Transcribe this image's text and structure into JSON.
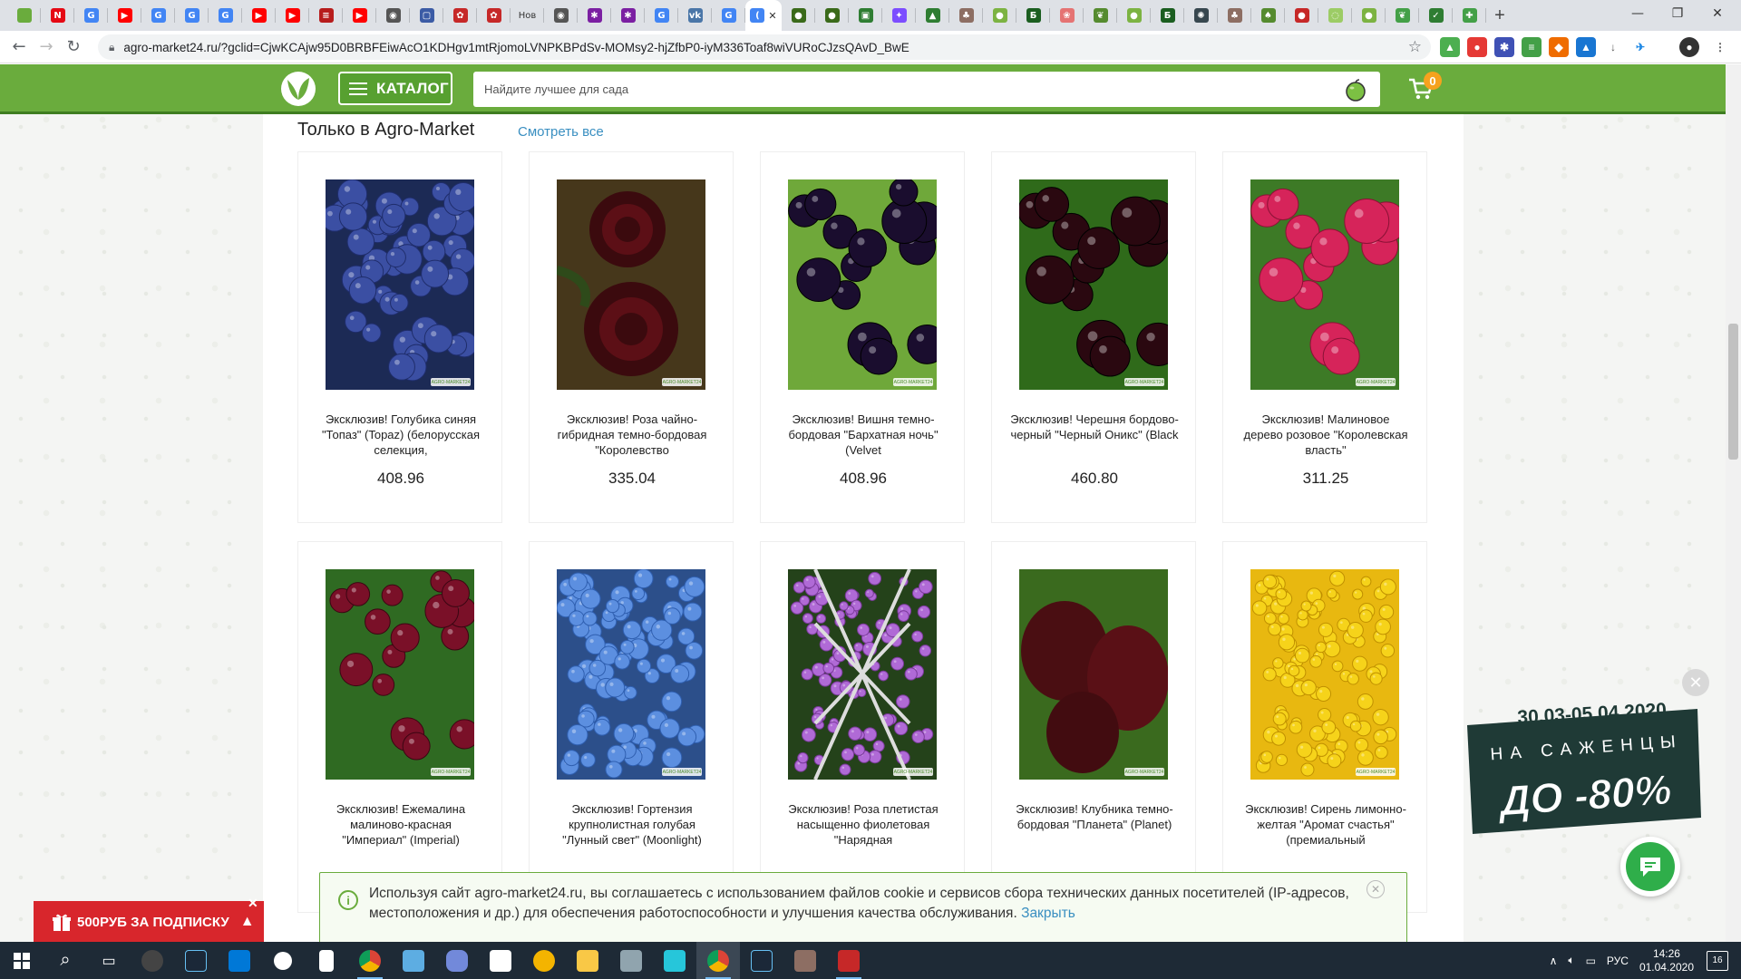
{
  "browser": {
    "url": "agro-market24.ru/?gclid=CjwKCAjw95D0BRBFEiwAcO1KDHgv1mtRjomoLVNPKBPdSv-MOMsy2-hjZfbP0-iyM336Toaf8wiVURoCJzsQAvD_BwE",
    "tabs": [
      {
        "icon": "leaf-icon",
        "color": "#6aac3d",
        "glyph": ""
      },
      {
        "icon": "netflix-icon",
        "color": "#e50914",
        "glyph": "N"
      },
      {
        "icon": "google-icon",
        "color": "#4285f4",
        "glyph": "G"
      },
      {
        "icon": "youtube-icon",
        "color": "#ff0000",
        "glyph": "▶"
      },
      {
        "icon": "google-icon",
        "color": "#4285f4",
        "glyph": "G"
      },
      {
        "icon": "google-icon",
        "color": "#4285f4",
        "glyph": "G"
      },
      {
        "icon": "google-icon",
        "color": "#4285f4",
        "glyph": "G"
      },
      {
        "icon": "youtube-icon",
        "color": "#ff0000",
        "glyph": "▶"
      },
      {
        "icon": "youtube-icon",
        "color": "#ff0000",
        "glyph": "▶"
      },
      {
        "icon": "calendar-icon",
        "color": "#b71c1c",
        "glyph": "≡"
      },
      {
        "icon": "youtube-icon",
        "color": "#ff0000",
        "glyph": "▶"
      },
      {
        "icon": "globe-icon",
        "color": "#555555",
        "glyph": "◉"
      },
      {
        "icon": "chat-icon",
        "color": "#3b5ba5",
        "glyph": "▢"
      },
      {
        "icon": "flower-icon",
        "color": "#c62828",
        "glyph": "✿"
      },
      {
        "icon": "flower-icon",
        "color": "#c62828",
        "glyph": "✿"
      },
      {
        "icon": "text-icon",
        "color": "#dee1e6",
        "glyph": "Нов"
      },
      {
        "icon": "globe-icon",
        "color": "#555555",
        "glyph": "◉"
      },
      {
        "icon": "star-icon",
        "color": "#7b1fa2",
        "glyph": "✱"
      },
      {
        "icon": "star-icon",
        "color": "#7b1fa2",
        "glyph": "✱"
      },
      {
        "icon": "google-icon",
        "color": "#4285f4",
        "glyph": "G"
      },
      {
        "icon": "vk-icon",
        "color": "#4a76a8",
        "glyph": "vk"
      },
      {
        "icon": "google-icon",
        "color": "#4285f4",
        "glyph": "G"
      },
      {
        "icon": "google-icon",
        "color": "#4285f4",
        "glyph": "("
      },
      {
        "icon": "fruit-icon",
        "color": "#3a6a1a",
        "glyph": "●"
      },
      {
        "icon": "fruit-icon",
        "color": "#3a6a1a",
        "glyph": "●"
      },
      {
        "icon": "box-icon",
        "color": "#2e7d32",
        "glyph": "▣"
      },
      {
        "icon": "sparkle-icon",
        "color": "#7c4dff",
        "glyph": "✦"
      },
      {
        "icon": "mountain-icon",
        "color": "#2e7d32",
        "glyph": "▲"
      },
      {
        "icon": "plant-icon",
        "color": "#8d6e63",
        "glyph": "♣"
      },
      {
        "icon": "apple-icon",
        "color": "#7cb342",
        "glyph": "●"
      },
      {
        "icon": "b-icon",
        "color": "#1b5e20",
        "glyph": "Б"
      },
      {
        "icon": "flower-icon",
        "color": "#e57373",
        "glyph": "❀"
      },
      {
        "icon": "leaf-icon",
        "color": "#558b2f",
        "glyph": "❦"
      },
      {
        "icon": "apple-icon",
        "color": "#7cb342",
        "glyph": "●"
      },
      {
        "icon": "b-icon",
        "color": "#1b5e20",
        "glyph": "Б"
      },
      {
        "icon": "plant-icon",
        "color": "#37474f",
        "glyph": "✺"
      },
      {
        "icon": "plant-icon",
        "color": "#8d6e63",
        "glyph": "♣"
      },
      {
        "icon": "plant-icon",
        "color": "#558b2f",
        "glyph": "♠"
      },
      {
        "icon": "berry-icon",
        "color": "#c62828",
        "glyph": "●"
      },
      {
        "icon": "leaf-icon",
        "color": "#9ccc65",
        "glyph": "◌"
      },
      {
        "icon": "leaf-icon",
        "color": "#7cb342",
        "glyph": "●"
      },
      {
        "icon": "leaf-icon",
        "color": "#43a047",
        "glyph": "❦"
      },
      {
        "icon": "leaf-icon",
        "color": "#2e7d32",
        "glyph": "✓"
      },
      {
        "icon": "leaf-icon",
        "color": "#43a047",
        "glyph": "✚"
      }
    ]
  },
  "site": {
    "catalog_label": "КАТАЛОГ",
    "search_placeholder": "Найдите лучшее для сада",
    "cart_count": "0",
    "section_title": "Только в Agro-Market",
    "see_all": "Смотреть все",
    "watermark": "AGRO-MARKET24",
    "products": [
      {
        "name": "Эксклюзив! Голубика синяя \"Топаз\" (Topaz) (белорусская селекция,",
        "price": "408.96",
        "image": "blueberry"
      },
      {
        "name": "Эксклюзив! Роза чайно-гибридная темно-бордовая \"Королевство",
        "price": "335.04",
        "image": "rose"
      },
      {
        "name": "Эксклюзив! Вишня темно-бордовая \"Бархатная ночь\" (Velvet",
        "price": "408.96",
        "image": "cherry"
      },
      {
        "name": "Эксклюзив! Черешня бордово-черный \"Черный Оникс\" (Black",
        "price": "460.80",
        "image": "sweetcherry"
      },
      {
        "name": "Эксклюзив! Малиновое дерево розовое \"Королевская власть\"",
        "price": "311.25",
        "image": "raspberry"
      },
      {
        "name": "Эксклюзив! Ежемалина малиново-красная \"Империал\" (Imperial)",
        "price": "",
        "image": "tayberry"
      },
      {
        "name": "Эксклюзив! Гортензия крупнолистная голубая \"Лунный свет\" (Moonlight)",
        "price": "",
        "image": "hydrangea"
      },
      {
        "name": "Эксклюзив! Роза плетистая насыщенно фиолетовая \"Нарядная",
        "price": "",
        "image": "climbingrose"
      },
      {
        "name": "Эксклюзив! Клубника темно-бордовая \"Планета\" (Planet)",
        "price": "",
        "image": "strawberry"
      },
      {
        "name": "Эксклюзив! Сирень лимонно-желтая \"Аромат счастья\" (премиальный",
        "price": "",
        "image": "lilac"
      }
    ],
    "cookie_text": "Используя сайт agro-market24.ru, вы соглашаетесь с использованием файлов cookie и сервисов сбора технических данных посетителей (IP-адресов, местоположения и др.) для обеспечения работоспособности и улучшения качества обслуживания.",
    "cookie_close": "Закрыть",
    "promo_label": "500РУБ ЗА ПОДПИСКУ",
    "sale_dates": "30.03-05.04.2020",
    "sale_subtitle": "НА САЖЕНЦЫ",
    "sale_discount": "ДО -80%"
  },
  "taskbar": {
    "lang": "РУС",
    "time": "14:26",
    "date": "01.04.2020",
    "notifications": "16"
  },
  "colors": {
    "brand_green": "#6aac3d",
    "accent_orange": "#f6a21e",
    "promo_red": "#d8262c",
    "link_blue": "#3a8fc1"
  }
}
